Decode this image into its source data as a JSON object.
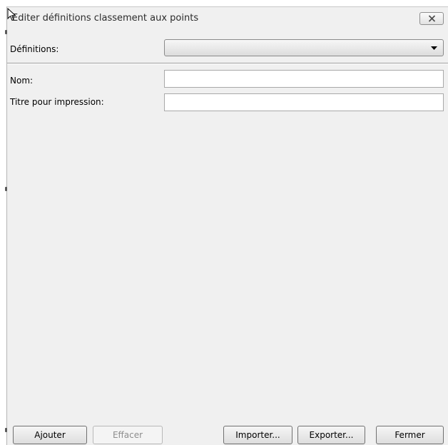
{
  "window": {
    "title": "Editer définitions classement aux points"
  },
  "form": {
    "definitions_label": "Définitions:",
    "definitions_value": "",
    "nom_label": "Nom:",
    "nom_value": "",
    "titre_label": "Titre pour impression:",
    "titre_value": ""
  },
  "buttons": {
    "ajouter": "Ajouter",
    "effacer": "Effacer",
    "importer": "Importer...",
    "exporter": "Exporter...",
    "fermer": "Fermer"
  },
  "icons": {
    "close": "close-icon",
    "dropdown": "chevron-down-icon",
    "cursor": "mouse-pointer-icon"
  },
  "colors": {
    "dialog_bg": "#f0f0f0",
    "disabled_text": "#8d8d8d"
  }
}
